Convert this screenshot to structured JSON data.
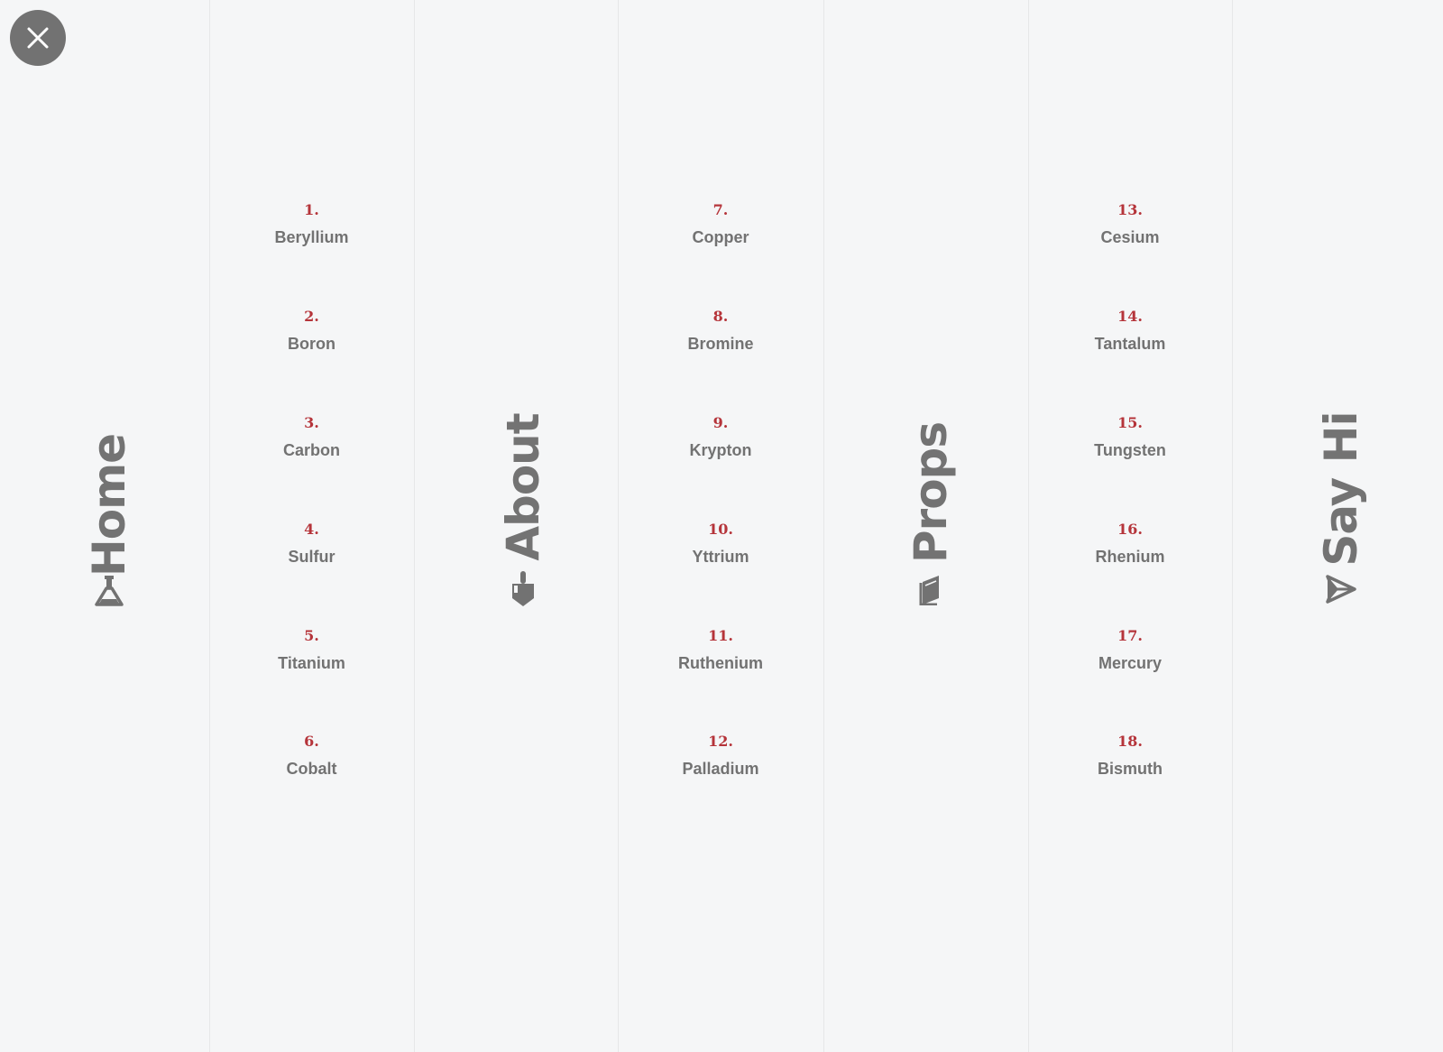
{
  "close_button": {
    "icon": "close-icon"
  },
  "nav": [
    {
      "label": "Home",
      "icon": "flask-icon"
    },
    {
      "label": "About",
      "icon": "hand-pointing-icon"
    },
    {
      "label": "Props",
      "icon": "book-icon"
    },
    {
      "label": "Say Hi",
      "icon": "paper-plane-icon"
    }
  ],
  "lists": [
    {
      "items": [
        {
          "num": "1.",
          "name": "Beryllium"
        },
        {
          "num": "2.",
          "name": "Boron"
        },
        {
          "num": "3.",
          "name": "Carbon"
        },
        {
          "num": "4.",
          "name": "Sulfur"
        },
        {
          "num": "5.",
          "name": "Titanium"
        },
        {
          "num": "6.",
          "name": "Cobalt"
        }
      ]
    },
    {
      "items": [
        {
          "num": "7.",
          "name": "Copper"
        },
        {
          "num": "8.",
          "name": "Bromine"
        },
        {
          "num": "9.",
          "name": "Krypton"
        },
        {
          "num": "10.",
          "name": "Yttrium"
        },
        {
          "num": "11.",
          "name": "Ruthenium"
        },
        {
          "num": "12.",
          "name": "Palladium"
        }
      ]
    },
    {
      "items": [
        {
          "num": "13.",
          "name": "Cesium"
        },
        {
          "num": "14.",
          "name": "Tantalum"
        },
        {
          "num": "15.",
          "name": "Tungsten"
        },
        {
          "num": "16.",
          "name": "Rhenium"
        },
        {
          "num": "17.",
          "name": "Mercury"
        },
        {
          "num": "18.",
          "name": "Bismuth"
        }
      ]
    }
  ],
  "colors": {
    "background": "#f5f6f7",
    "divider": "#e6e7e8",
    "text_gray": "#727272",
    "accent_red": "#b5343a",
    "close_bg": "#727272"
  }
}
